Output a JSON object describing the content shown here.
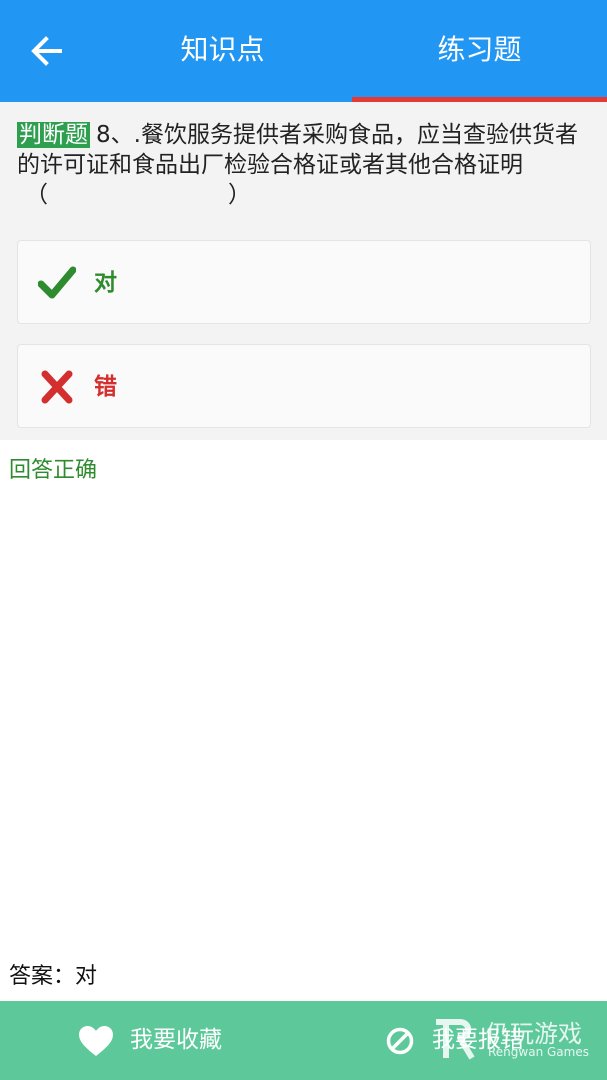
{
  "header": {
    "back_icon": "arrow-left-icon",
    "tabs": [
      {
        "label": "知识点",
        "active": false
      },
      {
        "label": "练习题",
        "active": true
      }
    ],
    "colors": {
      "background": "#2196F3",
      "active_underline": "#E53935"
    }
  },
  "question": {
    "tag": "判断题",
    "text": "8、.餐饮服务提供者采购食品，应当查验供货者的许可证和食品出厂检验合格证或者其他合格证明",
    "blank_open": "（",
    "blank_close": "）",
    "options": [
      {
        "label": "对",
        "icon": "check-icon",
        "color": "#2E8B2E"
      },
      {
        "label": "错",
        "icon": "cross-icon",
        "color": "#D32F2F"
      }
    ]
  },
  "result": {
    "text": "回答正确",
    "color": "#2E8B2E"
  },
  "answer": {
    "text": "答案：对"
  },
  "bottom_bar": {
    "favorite_label": "我要收藏",
    "favorite_icon": "heart-icon",
    "report_label": "我要报错",
    "report_icon": "block-icon",
    "background": "#5DC99B"
  },
  "watermark": {
    "cn": "仍玩游戏",
    "en": "Rengwan Games"
  }
}
